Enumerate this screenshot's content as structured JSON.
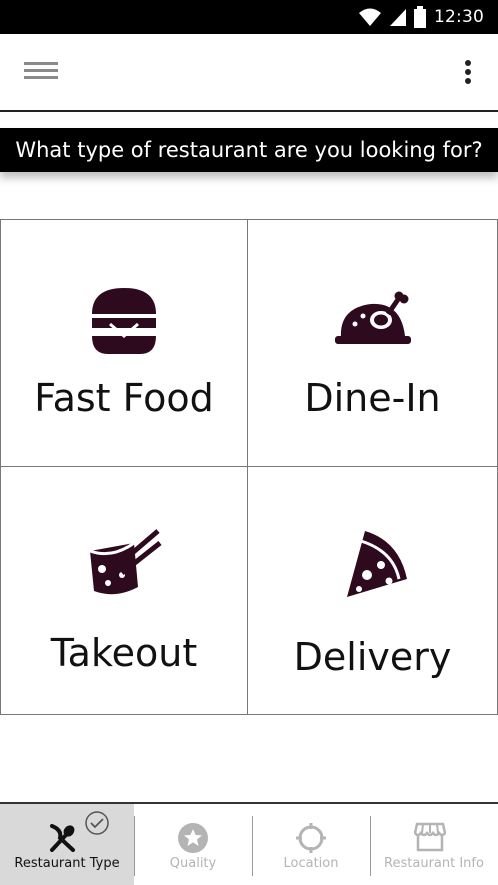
{
  "status_bar": {
    "time": "12:30",
    "icons": [
      "wifi-icon",
      "signal-icon",
      "battery-icon"
    ]
  },
  "app_bar": {
    "menu_icon": "hamburger-menu-icon",
    "more_icon": "more-vert-icon"
  },
  "question": {
    "text": "What type of restaurant are you looking for?"
  },
  "categories": [
    {
      "label": "Fast Food",
      "icon": "burger-icon"
    },
    {
      "label": "Dine-In",
      "icon": "roast-chicken-icon"
    },
    {
      "label": "Takeout",
      "icon": "takeout-box-chopsticks-icon"
    },
    {
      "label": "Delivery",
      "icon": "pizza-slice-icon"
    }
  ],
  "bottom_nav": {
    "items": [
      {
        "label": "Restaurant Type",
        "icon": "fork-knife-icon",
        "state": "active",
        "completed": true
      },
      {
        "label": "Quality",
        "icon": "star-icon",
        "state": "inactive"
      },
      {
        "label": "Location",
        "icon": "crosshair-icon",
        "state": "inactive"
      },
      {
        "label": "Restaurant Info",
        "icon": "storefront-icon",
        "state": "inactive"
      }
    ]
  },
  "colors": {
    "icon_accent": "#2e0a1e",
    "active_tab_bg": "#d9d9d9",
    "inactive_text": "#b4b4b4"
  }
}
